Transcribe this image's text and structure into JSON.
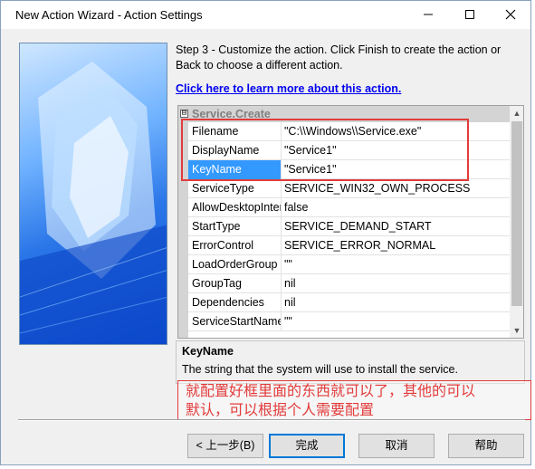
{
  "window": {
    "title": "New Action Wizard - Action Settings",
    "minimize_icon": "minimize-icon",
    "maximize_icon": "maximize-icon",
    "close_icon": "close-icon"
  },
  "instructions": "Step 3 - Customize the action.  Click Finish to create the action or Back to choose a different action.",
  "learn_more_link": "Click here to learn more about this action.",
  "property_grid": {
    "category": "Service.Create",
    "expander_symbol": "⊟",
    "rows": [
      {
        "name": "Filename",
        "value": "\"C:\\\\Windows\\\\Service.exe\""
      },
      {
        "name": "DisplayName",
        "value": "\"Service1\""
      },
      {
        "name": "KeyName",
        "value": "\"Service1\"",
        "selected": true
      },
      {
        "name": "ServiceType",
        "value": "SERVICE_WIN32_OWN_PROCESS"
      },
      {
        "name": "AllowDesktopInteract",
        "value": "false"
      },
      {
        "name": "StartType",
        "value": "SERVICE_DEMAND_START"
      },
      {
        "name": "ErrorControl",
        "value": "SERVICE_ERROR_NORMAL"
      },
      {
        "name": "LoadOrderGroup",
        "value": "\"\""
      },
      {
        "name": "GroupTag",
        "value": "nil"
      },
      {
        "name": "Dependencies",
        "value": "nil"
      },
      {
        "name": "ServiceStartName",
        "value": "\"\""
      }
    ]
  },
  "description": {
    "title": "KeyName",
    "text": "The string that the system will use to install the service."
  },
  "annotation": {
    "line1": "就配置好框里面的东西就可以了，其他的可以",
    "line2": "默认，可以根据个人需要配置"
  },
  "buttons": {
    "back": "< 上一步(B)",
    "finish": "完成",
    "cancel": "取消",
    "help": "帮助"
  },
  "colors": {
    "annotation_red": "#e23b3b",
    "selection_blue": "#3399ff",
    "link_blue": "#0000ee"
  }
}
